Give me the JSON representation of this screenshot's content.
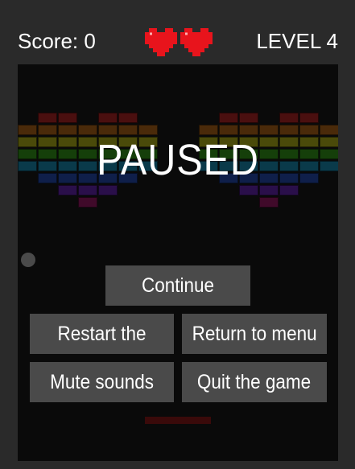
{
  "hud": {
    "score_text": "Score: 0",
    "level_text": "LEVEL 4",
    "lives": 2
  },
  "overlay": {
    "paused_text": "PAUSED"
  },
  "menu": {
    "continue": "Continue",
    "restart": "Restart the level",
    "return_menu": "Return to menu",
    "mute": "Mute sounds",
    "quit": "Quit the game"
  },
  "colors": {
    "heart": "#e8141c",
    "brick_rows": [
      "#4a0f0f",
      "#4a2a0a",
      "#4a4a0a",
      "#153f0a",
      "#0a3a4a",
      "#0f1f4a",
      "#2a0f4a",
      "#400a2a"
    ]
  }
}
